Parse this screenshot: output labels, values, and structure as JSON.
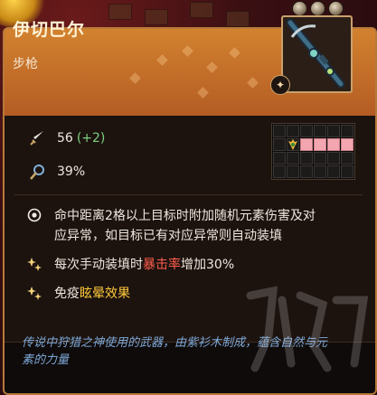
{
  "weapon": {
    "name": "伊切巴尔",
    "type": "步枪",
    "rarity_count": 3
  },
  "stats": {
    "attack": {
      "value": "56",
      "bonus": "(+2)",
      "icon": "sword-icon"
    },
    "crit": {
      "value": "39%",
      "icon": "crit-icon"
    }
  },
  "range_grid": {
    "rows": 4,
    "cols": 6,
    "self": [
      1,
      1
    ],
    "hits": [
      [
        1,
        2
      ],
      [
        1,
        3
      ],
      [
        1,
        4
      ],
      [
        1,
        5
      ]
    ]
  },
  "traits": [
    {
      "icon": "target-icon",
      "text": "命中距离2格以上目标时附加随机元素伤害及对应异常，如目标已有对应异常则自动装填"
    },
    {
      "icon": "stars-icon",
      "pre": "每次手动装填时",
      "highlight": "暴击率",
      "post": "增加30%"
    },
    {
      "icon": "stars-icon",
      "pre": "免疫",
      "highlight": "眩晕效果",
      "post": ""
    }
  ],
  "flavor_text": "传说中狩猎之神使用的武器，由紫衫木制成，蕴含自然与元素的力量",
  "colors": {
    "header": "#c7722a",
    "bonus_green": "#7ed07e",
    "highlight_red": "#ff5d4c",
    "highlight_gold": "#ffca3a",
    "flavor_blue": "#7fa9d8"
  }
}
